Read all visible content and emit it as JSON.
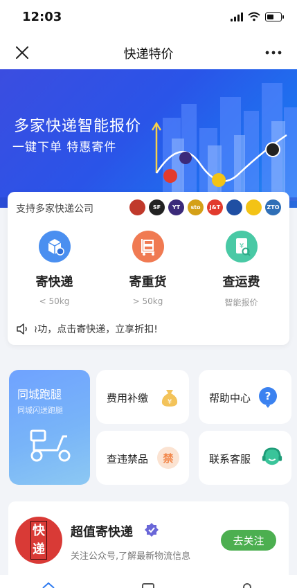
{
  "status_bar": {
    "time": "12:03"
  },
  "nav": {
    "title": "快递特价"
  },
  "banner": {
    "headline": "多家快递智能报价",
    "tagline": "一键下单 特惠寄件"
  },
  "carriers": {
    "label": "支持多家快递公司",
    "logos": [
      {
        "icon": "carrier-1-logo",
        "text": "",
        "color": "#c0392b"
      },
      {
        "icon": "sf-logo",
        "text": "SF",
        "color": "#222222"
      },
      {
        "icon": "yto-logo",
        "text": "YT",
        "color": "#3b2a7a"
      },
      {
        "icon": "sto-logo",
        "text": "sto",
        "color": "#d4a017"
      },
      {
        "icon": "jt-logo",
        "text": "J&T",
        "color": "#e23b2e"
      },
      {
        "icon": "carrier-6-logo",
        "text": "",
        "color": "#1f4fa3"
      },
      {
        "icon": "yunda-logo",
        "text": "",
        "color": "#f3c316"
      },
      {
        "icon": "zto-logo",
        "text": "ZTO",
        "color": "#2f6fb7"
      }
    ]
  },
  "services": [
    {
      "title": "寄快递",
      "subtitle": "< 50kg",
      "icon": "package-icon",
      "color": "#4a8ff0"
    },
    {
      "title": "寄重货",
      "subtitle": "> 50kg",
      "icon": "cart-icon",
      "color": "#f07a52"
    },
    {
      "title": "查运费",
      "subtitle": "智能报价",
      "icon": "price-search-icon",
      "color": "#49c9a5"
    }
  ],
  "notice": {
    "text": "≀功，点击寄快递，立享折扣!"
  },
  "errand": {
    "title": "同城跑腿",
    "subtitle": "同城闪送跑腿",
    "icon": "scooter-icon"
  },
  "tiles": [
    {
      "label": "费用补缴",
      "icon": "money-bag-icon",
      "color": "#f3c35a"
    },
    {
      "label": "帮助中心",
      "icon": "help-icon",
      "color": "#3b82f0"
    },
    {
      "label": "查违禁品",
      "icon": "prohibited-icon",
      "color": "#f2874a",
      "glyph": "禁"
    },
    {
      "label": "联系客服",
      "icon": "customer-service-icon",
      "color": "#3ac49a"
    }
  ],
  "follow_card": {
    "seal_text": "快递",
    "title": "超值寄快递",
    "subtitle": "关注公众号,了解最新物流信息",
    "button": "去关注",
    "verified_icon": "verified-icon"
  },
  "tabbar": {
    "icons": [
      "home-tab-icon",
      "orders-tab-icon",
      "profile-tab-icon"
    ]
  }
}
